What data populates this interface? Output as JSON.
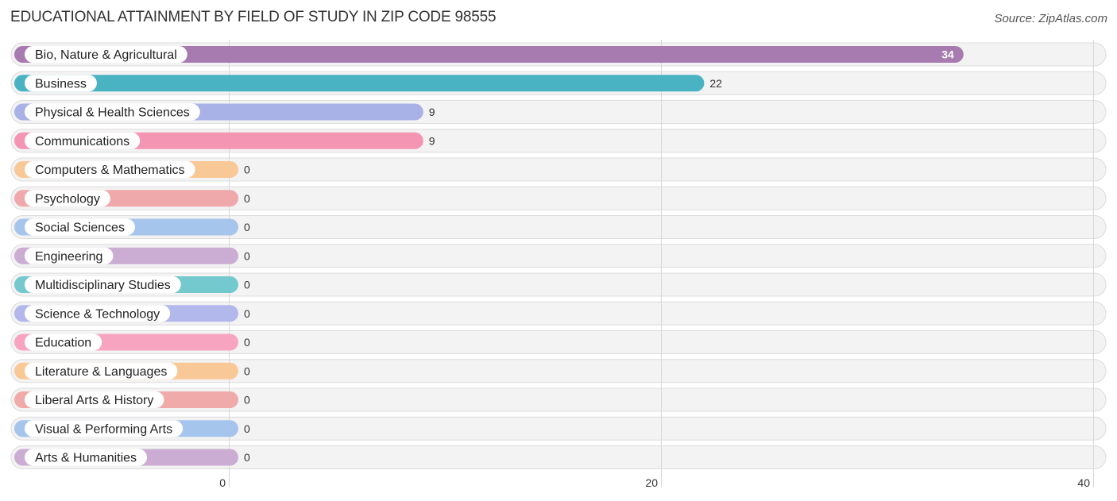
{
  "chart_data": {
    "type": "bar",
    "orientation": "horizontal",
    "title": "EDUCATIONAL ATTAINMENT BY FIELD OF STUDY IN ZIP CODE 98555",
    "source": "Source: ZipAtlas.com",
    "xlabel": "",
    "ylabel": "",
    "xlim": [
      0,
      40
    ],
    "x_ticks": [
      0,
      20,
      40
    ],
    "grid": true,
    "legend": "none",
    "categories": [
      "Bio, Nature & Agricultural",
      "Business",
      "Physical & Health Sciences",
      "Communications",
      "Computers & Mathematics",
      "Psychology",
      "Social Sciences",
      "Engineering",
      "Multidisciplinary Studies",
      "Science & Technology",
      "Education",
      "Literature & Languages",
      "Liberal Arts & History",
      "Visual & Performing Arts",
      "Arts & Humanities"
    ],
    "values": [
      34,
      22,
      9,
      9,
      0,
      0,
      0,
      0,
      0,
      0,
      0,
      0,
      0,
      0,
      0
    ],
    "colors": [
      "#a87bb0",
      "#4ab3c3",
      "#a9b2e6",
      "#f595b4",
      "#f9c897",
      "#f0a9aa",
      "#a6c5ec",
      "#cbadd3",
      "#73c9cd",
      "#b3b8ec",
      "#f7a4c1",
      "#f9c897",
      "#f0aaaa",
      "#a6c5ec",
      "#cbadd3"
    ]
  }
}
